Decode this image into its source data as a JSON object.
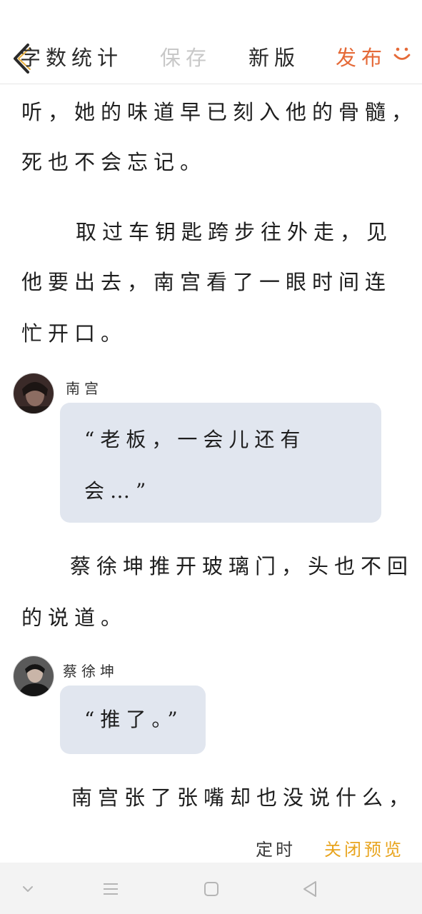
{
  "header": {
    "back_icon": "chevron-left-icon",
    "word_count": "字数统计",
    "save": "保存",
    "new_version": "新版",
    "publish": "发布",
    "smile_icon": "smile-icon",
    "accent_color": "#e56a38",
    "disabled_color": "#c8c8c8"
  },
  "story": {
    "p1": [
      "听，她的味道早已刻入他的骨髓，",
      "死也不会忘记。"
    ],
    "p2": [
      "取过车钥匙跨步往外走，见",
      "他要出去，南宫看了一眼时间连",
      "忙开口。"
    ],
    "dialog1": {
      "speaker": "南宫",
      "lines": [
        "“老板，一会儿还有",
        "会…”"
      ]
    },
    "p3": [
      "蔡徐坤推开玻璃门，头也不回",
      "的说道。"
    ],
    "dialog2": {
      "speaker": "蔡徐坤",
      "lines": [
        "“推了。”"
      ]
    },
    "p4": [
      "南宫张了张嘴却也没说什么，"
    ]
  },
  "footer": {
    "timer": "定时",
    "close_preview": "关闭预览",
    "close_color": "#e8a41e"
  },
  "system_nav": {
    "icons": [
      "chevron-down-icon",
      "menu-icon",
      "home-square-icon",
      "back-triangle-icon"
    ],
    "bar_color": "#f3f3f3"
  },
  "bubble_color": "#e1e6ef"
}
